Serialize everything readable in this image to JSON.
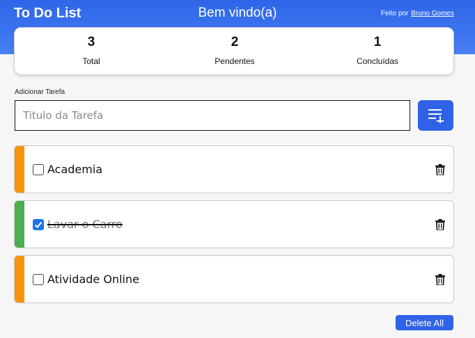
{
  "header": {
    "app_title": "To Do List",
    "welcome": "Bem vindo(a)",
    "credit_prefix": "Feito por",
    "credit_author": "Bruno Gomes"
  },
  "stats": {
    "total": {
      "value": "3",
      "label": "Total"
    },
    "pending": {
      "value": "2",
      "label": "Pendentes"
    },
    "done": {
      "value": "1",
      "label": "Concluídas"
    }
  },
  "add_task": {
    "label": "Adicionar Tarefa",
    "placeholder": "Titulo da Tarefa",
    "button_icon": "playlist-add-icon"
  },
  "tasks": [
    {
      "title": "Academia",
      "completed": false,
      "status_color": "#f7930f"
    },
    {
      "title": "Lavar o Carro",
      "completed": true,
      "status_color": "#4caf50"
    },
    {
      "title": "Atividade Online",
      "completed": false,
      "status_color": "#f7930f"
    }
  ],
  "delete_all_label": "Delete All",
  "colors": {
    "primary": "#2f62e6",
    "pending": "#f7930f",
    "done": "#4caf50"
  }
}
